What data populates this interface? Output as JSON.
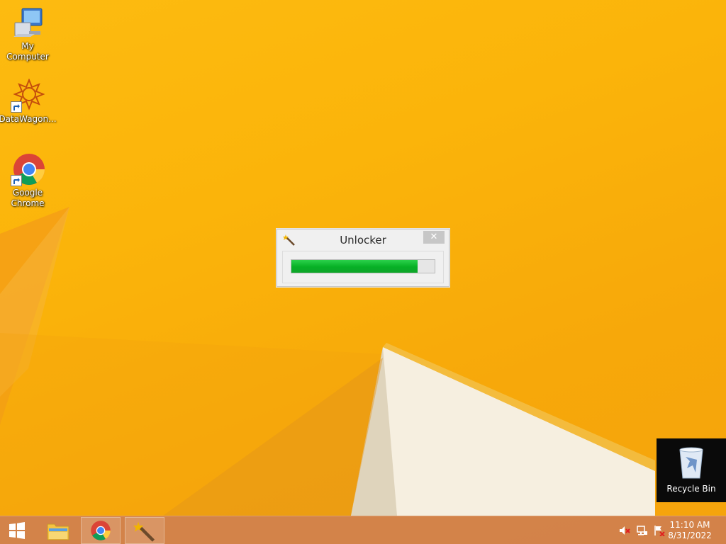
{
  "desktop": {
    "icons": [
      {
        "label": "My Computer",
        "icon": "computer-icon"
      },
      {
        "label": "DataWagon...",
        "icon": "datawagon-icon"
      },
      {
        "label": "Google\nChrome",
        "icon": "chrome-icon"
      }
    ],
    "recycle_bin": {
      "label": "Recycle Bin",
      "icon": "recycle-bin-icon"
    }
  },
  "dialog": {
    "title": "Unlocker",
    "close_glyph": "✕",
    "progress_fraction": 0.88,
    "progress_color": "#06b025"
  },
  "taskbar": {
    "apps": [
      {
        "name": "start",
        "icon": "windows-logo-icon"
      },
      {
        "name": "file-explorer",
        "icon": "folder-icon"
      },
      {
        "name": "chrome",
        "icon": "chrome-icon"
      },
      {
        "name": "unlocker",
        "icon": "wand-icon"
      }
    ],
    "tray": [
      "speaker-muted-icon",
      "network-icon",
      "action-center-flag-icon"
    ],
    "clock": {
      "time": "11:10 AM",
      "date": "8/31/2022"
    }
  },
  "colors": {
    "wallpaper": "#fbb40a",
    "taskbar": "#cd7d55"
  }
}
